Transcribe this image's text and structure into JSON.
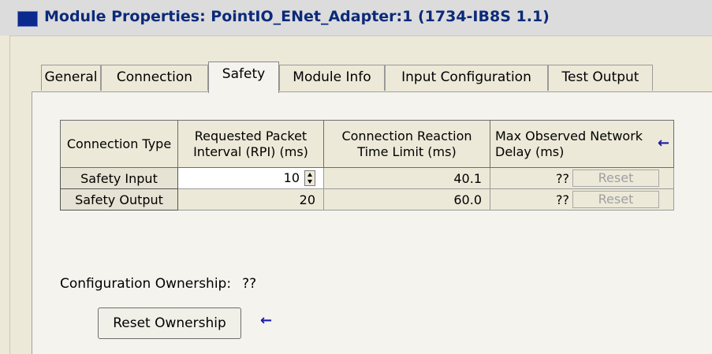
{
  "window": {
    "title": "Module Properties: PointIO_ENet_Adapter:1 (1734-IB8S 1.1)"
  },
  "tabs": [
    {
      "label": "General"
    },
    {
      "label": "Connection"
    },
    {
      "label": "Safety"
    },
    {
      "label": "Module Info"
    },
    {
      "label": "Input Configuration"
    },
    {
      "label": "Test Output"
    }
  ],
  "active_tab": "Safety",
  "table": {
    "headers": [
      "Connection Type",
      "Requested Packet Interval (RPI) (ms)",
      "Connection Reaction Time Limit (ms)",
      "Max Observed Network Delay (ms)"
    ],
    "rows": [
      {
        "type": "Safety Input",
        "rpi": "10",
        "reaction": "40.1",
        "delay": "??",
        "reset": "Reset"
      },
      {
        "type": "Safety Output",
        "rpi": "20",
        "reaction": "60.0",
        "delay": "??",
        "reset": "Reset"
      }
    ]
  },
  "ownership": {
    "label": "Configuration Ownership:",
    "value": "??",
    "button": "Reset Ownership"
  },
  "annotations": {
    "arrow_glyph": "←",
    "arrow_color": "#1a1aa8"
  }
}
